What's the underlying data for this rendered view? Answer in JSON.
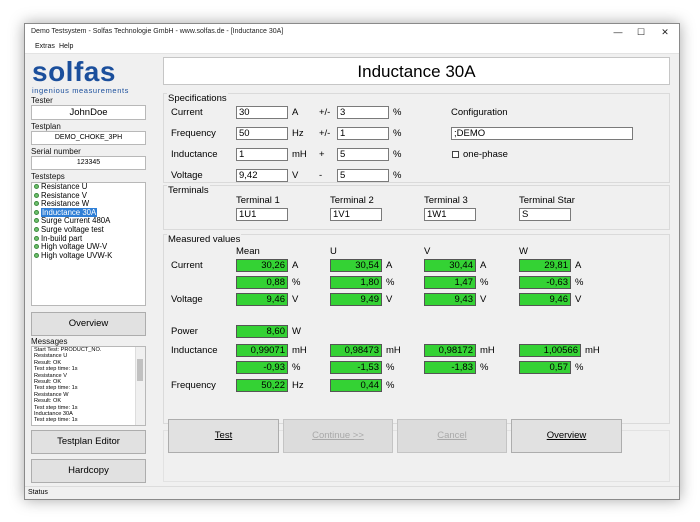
{
  "window": {
    "title": "Demo Testsystem - Solfas Technologie GmbH - www.solfas.de - [Inductance 30A]"
  },
  "menu": [
    "Extras",
    "Help"
  ],
  "logo": {
    "word": "solfas",
    "tagline": "ingenious measurements"
  },
  "sidebar": {
    "tester_label": "Tester",
    "tester_value": "JohnDoe",
    "testplan_label": "Testplan",
    "testplan_value": "DEMO_CHOKE_3PH",
    "serial_label": "Serial number",
    "serial_value": "123345",
    "teststeps_label": "Teststeps",
    "teststeps": [
      "Resistance U",
      "Resistance V",
      "Resistance W",
      "Inductance 30A",
      "Surge Current 480A",
      "Surge voltage test",
      "In-build part",
      "High voltage UW-V",
      "High voltage UVW-K"
    ],
    "selected_step": 3,
    "overview_button": "Overview",
    "messages_label": "Messages",
    "messages": [
      "Start Test: PRODUCT_NO.",
      "Resistance U",
      "Result: OK",
      "Test step time: 1s",
      "Resistance V",
      "Result: OK",
      "Test step time: 1s",
      "Resistance W",
      "Result: OK",
      "Test step time: 1s",
      "Inductance 30A",
      "Test step time: 1s"
    ],
    "testplan_editor_button": "Testplan Editor",
    "hardcopy_button": "Hardcopy"
  },
  "main": {
    "title": "Inductance 30A",
    "specs": {
      "label": "Specifications",
      "rows": [
        {
          "name": "Current",
          "value": "30",
          "unit": "A",
          "op": "+/-",
          "tol": "3",
          "tol_unit": "%"
        },
        {
          "name": "Frequency",
          "value": "50",
          "unit": "Hz",
          "op": "+/-",
          "tol": "1",
          "tol_unit": "%"
        },
        {
          "name": "Inductance",
          "value": "1",
          "unit": "mH",
          "op": "+",
          "tol": "5",
          "tol_unit": "%"
        },
        {
          "name": "Voltage",
          "value": "9,42",
          "unit": "V",
          "op": "-",
          "tol": "5",
          "tol_unit": "%"
        }
      ],
      "configuration_label": "Configuration",
      "configuration_value": ";DEMO",
      "one_phase_label": "one-phase"
    },
    "terminals": {
      "label": "Terminals",
      "items": [
        {
          "name": "Terminal 1",
          "value": "1U1"
        },
        {
          "name": "Terminal 2",
          "value": "1V1"
        },
        {
          "name": "Terminal 3",
          "value": "1W1"
        },
        {
          "name": "Terminal Star",
          "value": "S"
        }
      ]
    },
    "measured": {
      "label": "Measured values",
      "columns": [
        "Mean",
        "U",
        "V",
        "W"
      ],
      "current_label": "Current",
      "voltage_label": "Voltage",
      "power_label": "Power",
      "inductance_label": "Inductance",
      "frequency_label": "Frequency",
      "current": [
        [
          "30,26",
          "30,54",
          "30,44",
          "29,81"
        ],
        "A"
      ],
      "current_pct": [
        [
          "0,88",
          "1,80",
          "1,47",
          "-0,63"
        ],
        "%"
      ],
      "voltage": [
        [
          "9,46",
          "9,49",
          "9,43",
          "9,46"
        ],
        "V"
      ],
      "power": [
        "8,60",
        "W"
      ],
      "inductance": [
        [
          "0,99071",
          "0,98473",
          "0,98172",
          "1,00566"
        ],
        "mH"
      ],
      "inductance_pct": [
        [
          "-0,93",
          "-1,53",
          "-1,83",
          "0,57"
        ],
        "%"
      ],
      "frequency": [
        [
          "50,22",
          "0,44"
        ],
        [
          "Hz",
          "%"
        ]
      ]
    },
    "buttons": {
      "test": "Test",
      "continue": "Continue >>",
      "cancel": "Cancel",
      "overview": "Overview"
    }
  },
  "status": "Status",
  "colors": {
    "measured_ok": "#34d234",
    "logo_blue": "#1b4f9c",
    "logo_red": "#d13a1e",
    "selection": "#2f7fd6"
  }
}
